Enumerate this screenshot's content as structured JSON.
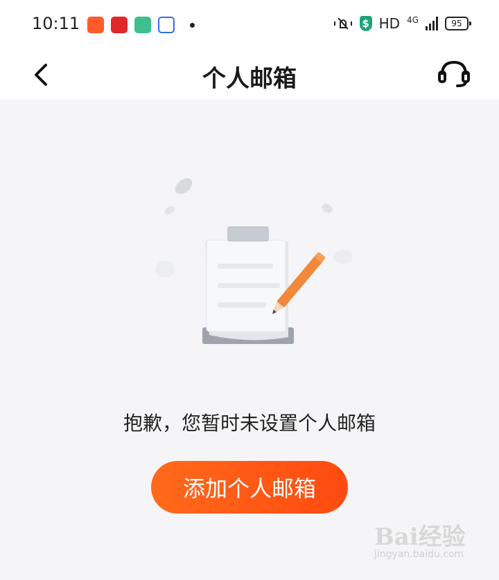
{
  "status_bar": {
    "time": "10:11",
    "network": "HD",
    "network_type": "4G",
    "battery": "95"
  },
  "nav": {
    "title": "个人邮箱"
  },
  "empty_state": {
    "message": "抱歉，您暂时未设置个人邮箱",
    "button_label": "添加个人邮箱"
  },
  "watermark": {
    "brand": "Bai经验",
    "url": "jingyan.baidu.com"
  },
  "colors": {
    "accent": "#ff5a14",
    "background": "#f5f5f7"
  }
}
